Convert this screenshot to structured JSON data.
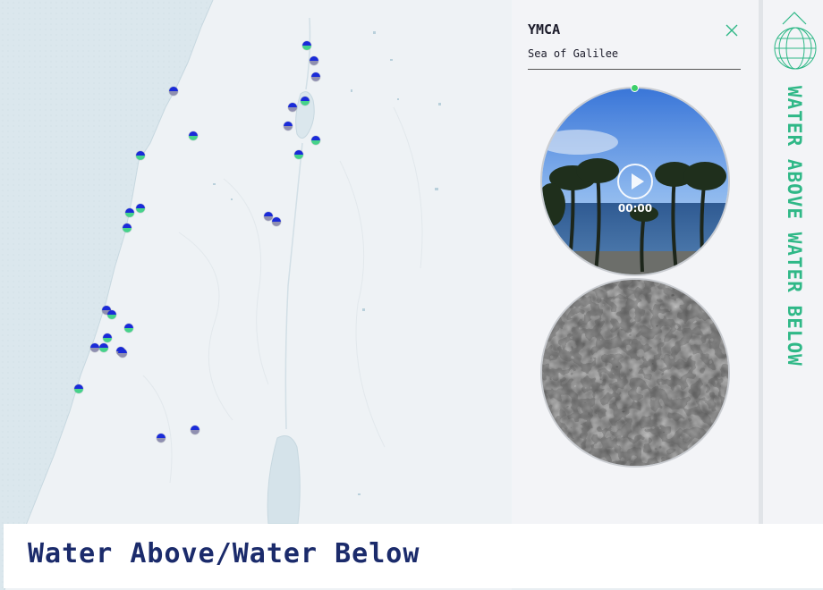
{
  "map": {
    "markers": [
      {
        "label": "marker-1",
        "below_color": "#46d28a"
      },
      {
        "label": "marker-2",
        "below_color": "#8f8fb0"
      },
      {
        "label": "marker-3",
        "below_color": "#8f8fb0"
      },
      {
        "label": "marker-4",
        "below_color": "#8f8fb0"
      },
      {
        "label": "marker-5",
        "below_color": "#46d28a"
      },
      {
        "label": "marker-6",
        "below_color": "#8f8fb0"
      },
      {
        "label": "marker-7",
        "below_color": "#8f8fb0"
      },
      {
        "label": "marker-8",
        "below_color": "#46d28a"
      },
      {
        "label": "marker-9",
        "below_color": "#46d28a"
      },
      {
        "label": "marker-10",
        "below_color": "#46d28a"
      },
      {
        "label": "marker-11",
        "below_color": "#46d28a"
      },
      {
        "label": "marker-12",
        "below_color": "#46d28a"
      },
      {
        "label": "marker-13",
        "below_color": "#46d28a"
      },
      {
        "label": "marker-14",
        "below_color": "#46d28a"
      },
      {
        "label": "marker-15",
        "below_color": "#8f8fb0"
      },
      {
        "label": "marker-16",
        "below_color": "#8f8fb0"
      },
      {
        "label": "marker-17",
        "below_color": "#8f8fb0"
      },
      {
        "label": "marker-18",
        "below_color": "#46d28a"
      },
      {
        "label": "marker-19",
        "below_color": "#46d28a"
      },
      {
        "label": "marker-20",
        "below_color": "#46d28a"
      },
      {
        "label": "marker-21",
        "below_color": "#8f8fb0"
      },
      {
        "label": "marker-22",
        "below_color": "#46d28a"
      },
      {
        "label": "marker-23",
        "below_color": "#8f8fb0"
      },
      {
        "label": "marker-24",
        "below_color": "#8f8fb0"
      },
      {
        "label": "marker-25",
        "below_color": "#46d28a"
      },
      {
        "label": "marker-26",
        "below_color": "#8f8fb0"
      },
      {
        "label": "marker-27",
        "below_color": "#8f8fb0"
      }
    ]
  },
  "panel": {
    "title": "YMCA",
    "subtitle": "Sea of Galilee",
    "close_icon": "close-icon",
    "video": {
      "timecode": "00:00",
      "play_icon": "play-icon"
    }
  },
  "sidebar": {
    "nav_icon": "chevron-up-icon",
    "logo_icon": "globe-logo-icon",
    "vertical_title": "WATER ABOVE WATER BELOW"
  },
  "banner": {
    "title": "Water Above/Water Below"
  },
  "colors": {
    "marker_top": "#1a2bd8",
    "accent_green": "#2fb887",
    "banner_text": "#1b2b6b",
    "sea": "#dbe8ee",
    "land": "#eef2f5"
  }
}
